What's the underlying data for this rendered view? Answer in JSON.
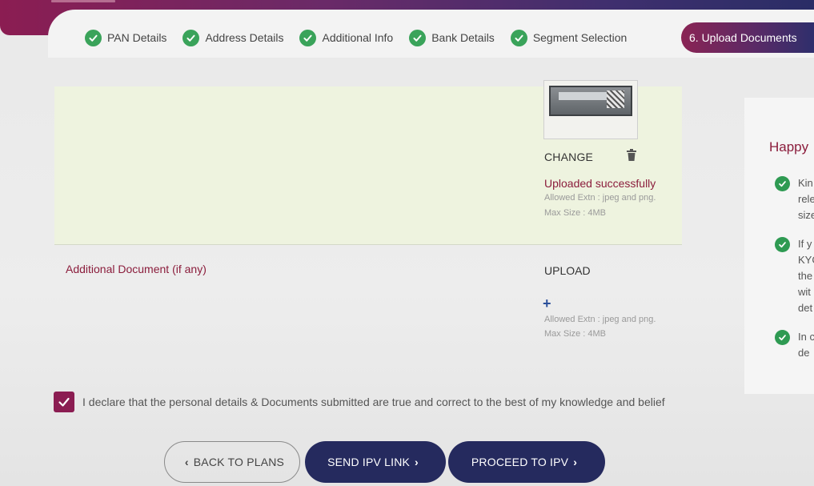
{
  "steps": [
    {
      "label": "PAN Details",
      "state": "done"
    },
    {
      "label": "Address Details",
      "state": "done"
    },
    {
      "label": "Additional Info",
      "state": "done"
    },
    {
      "label": "Bank Details",
      "state": "done"
    },
    {
      "label": "Segment Selection",
      "state": "done"
    },
    {
      "label": "6. Upload Documents",
      "state": "active"
    }
  ],
  "document": {
    "change_label": "CHANGE",
    "status": "Uploaded successfully",
    "allowed_ext": "Allowed Extn : jpeg and png.",
    "max_size": "Max Size : 4MB"
  },
  "additional_document": {
    "label": "Additional Document (if any)",
    "upload_label": "UPLOAD",
    "plus_icon": "+",
    "allowed_ext": "Allowed Extn : jpeg and png.",
    "max_size": "Max Size : 4MB"
  },
  "info_panel": {
    "title": "Happy",
    "items": [
      {
        "lines": "Kin\nrele\nsize"
      },
      {
        "lines": "If y\nKYC\nthe\nwit\ndet"
      },
      {
        "lines": "In c\nde"
      }
    ]
  },
  "declaration": {
    "checked": true,
    "text": "I declare that the personal details & Documents submitted are true and correct to the best of my knowledge and belief"
  },
  "buttons": {
    "back": "BACK TO PLANS",
    "send_ipv": "SEND IPV LINK",
    "proceed": "PROCEED TO IPV"
  },
  "colors": {
    "brand_maroon": "#8b1d3c",
    "brand_navy": "#252a5e",
    "success_green": "#3aa35a",
    "panel_bg": "#eef3df"
  }
}
